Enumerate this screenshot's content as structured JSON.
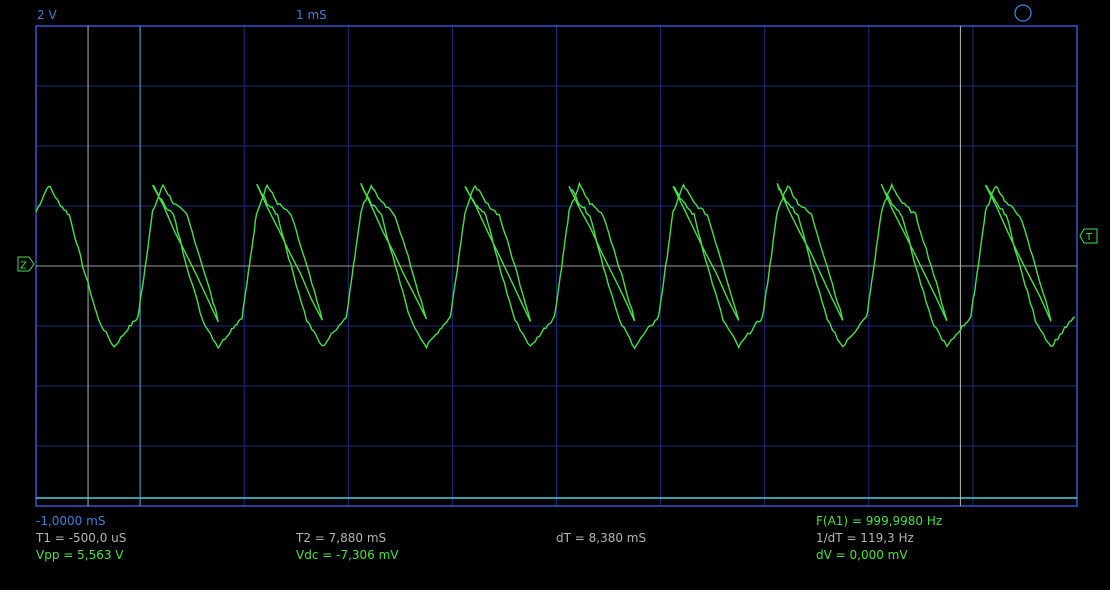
{
  "header": {
    "volts_per_div": "2 V",
    "time_per_div": "1 mS"
  },
  "markers": {
    "channel_marker": "Z",
    "trigger_marker": "T"
  },
  "readouts": {
    "start_time": "-1,0000 mS",
    "t1": "T1 = -500,0 uS",
    "t2": "T2 = 7,880 mS",
    "dt": "dT = 8,380 mS",
    "freq": "F(A1) = 999,9980 Hz",
    "inv_dt": "1/dT = 119,3 Hz",
    "vpp": "Vpp = 5,563 V",
    "vdc": "Vdc = -7,306 mV",
    "dv": "dV = 0,000 mV"
  },
  "colors": {
    "background": "#000000",
    "grid": "#1a2d7a",
    "frame": "#3355cc",
    "trace": "#48e048",
    "cursor_time": "#b4b4b4",
    "cursor_blue": "#4aa8d8",
    "level_line": "#4ad0e0",
    "center_line": "#9a9a9a"
  },
  "chart_data": {
    "type": "line",
    "title": "",
    "xlabel": "",
    "ylabel": "",
    "x_unit": "ms",
    "y_unit": "V",
    "xlim": [
      -1.0,
      9.0
    ],
    "ylim": [
      -8.0,
      8.0
    ],
    "x_divisions": 10,
    "y_divisions": 8,
    "grid": true,
    "series": [
      {
        "frequency_hz": 999.998,
        "amplitude_pp_v": 5.563,
        "offset_v": -0.0073,
        "x": [
          -1.0,
          -0.88,
          -0.78,
          -0.68,
          -0.55,
          -0.4,
          -0.25,
          -0.12,
          -0.02,
          0.05,
          0.12,
          0.22,
          0.32,
          0.45,
          0.6,
          0.75
        ],
        "y": [
          1.8,
          2.7,
          2.1,
          1.7,
          0.0,
          -1.8,
          -2.7,
          -2.1,
          -1.7,
          0.0,
          1.8,
          2.7,
          2.1,
          1.7,
          0.0,
          -1.8
        ]
      }
    ],
    "cursors": {
      "t1_ms": -0.5,
      "t2_ms": 7.88,
      "t_blue_ms": 0.0
    }
  }
}
